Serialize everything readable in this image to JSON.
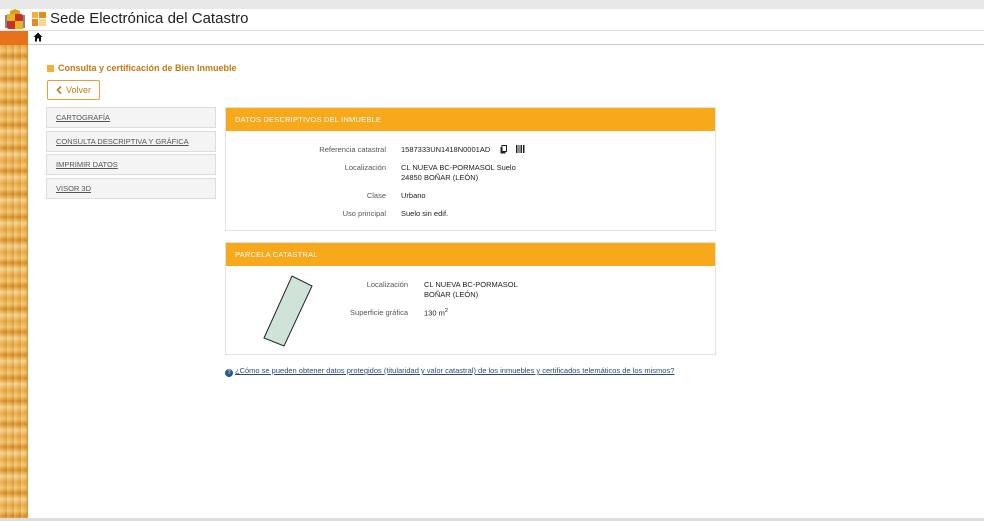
{
  "header": {
    "site_title": "Sede Electrónica del Catastro"
  },
  "page": {
    "title": "Consulta y certificación de Bien Inmueble",
    "back_label": "Volver"
  },
  "sidebar": {
    "items": [
      {
        "label": "CARTOGRAFÍA"
      },
      {
        "label": "CONSULTA DESCRIPTIVA Y GRÁFICA"
      },
      {
        "label": "IMPRIMIR DATOS"
      },
      {
        "label": "VISOR 3D"
      }
    ]
  },
  "datos": {
    "heading": "DATOS DESCRIPTIVOS DEL INMUEBLE",
    "ref_label": "Referencia catastral",
    "ref_value": "1587333UN1418N0001AD",
    "loc_label": "Localización",
    "loc_line1": "CL NUEVA BC-PORMASOL Suelo",
    "loc_line2": "24850 BOÑAR (LEÓN)",
    "clase_label": "Clase",
    "clase_value": "Urbano",
    "uso_label": "Uso principal",
    "uso_value": "Suelo sin edif."
  },
  "parcela": {
    "heading": "PARCELA CATASTRAL",
    "loc_label": "Localización",
    "loc_line1": "CL NUEVA BC-PORMASOL",
    "loc_line2": "BOÑAR (LEÓN)",
    "sup_label": "Superficie gráfica",
    "sup_value": "130 m",
    "sup_unit_exp": "2"
  },
  "info": {
    "link_text": "¿Cómo se pueden obtener datos protegidos (titularidad y valor catastral) de los inmuebles y certificados telemáticos de los mismos?"
  },
  "colors": {
    "accent": "#f7a81b",
    "title_orange": "#c47a10",
    "parcel_fill": "#cfe3d8"
  }
}
